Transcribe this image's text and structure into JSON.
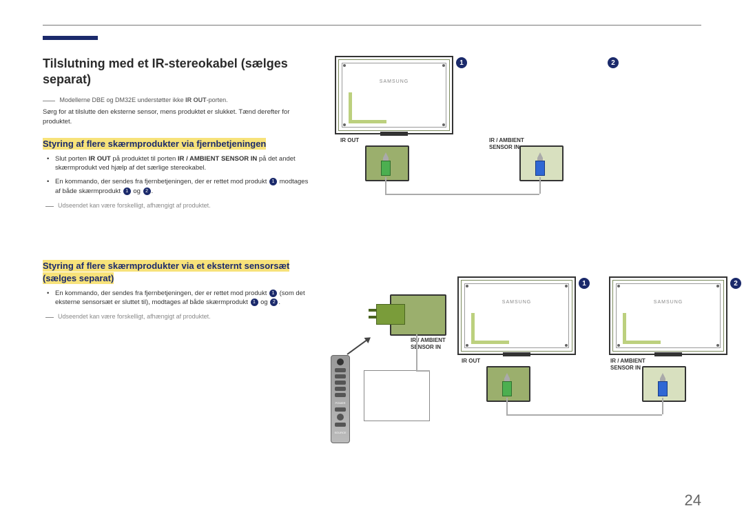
{
  "page_number": "24",
  "title": "Tilslutning med et IR-stereokabel (sælges separat)",
  "note_models_prefix": "Modellerne DBE og DM32E understøtter ikke ",
  "note_models_bold": "IR OUT",
  "note_models_suffix": "-porten.",
  "body1": "Sørg for at tilslutte den eksterne sensor, mens produktet er slukket. Tænd derefter for produktet.",
  "section1": {
    "heading": "Styring af flere skærmprodukter via fjernbetjeningen",
    "bullet1_a": "Slut porten ",
    "bullet1_b": "IR OUT",
    "bullet1_c": " på produktet til porten ",
    "bullet1_d": "IR / AMBIENT SENSOR IN",
    "bullet1_e": " på det andet skærmprodukt ved hjælp af det særlige stereokabel.",
    "bullet2_a": "En kommando, der sendes fra fjernbetjeningen, der er rettet mod produkt ",
    "bullet2_b": " modtages af både skærmprodukt ",
    "bullet2_c": " og ",
    "bullet2_d": ".",
    "note": "Udseendet kan være forskelligt, afhængigt af produktet."
  },
  "section2": {
    "heading": "Styring af flere skærmprodukter via et eksternt sensorsæt (sælges separat)",
    "bullet1_a": "En kommando, der sendes fra fjernbetjeningen, der er rettet mod produkt ",
    "bullet1_b": " (som det eksterne sensorsæt er sluttet til), modtages af både skærmprodukt ",
    "bullet1_c": " og ",
    "bullet1_d": ".",
    "note": "Udseendet kan være forskelligt, afhængigt af produktet."
  },
  "labels": {
    "ir_out": "IR OUT",
    "ir_ambient": "IR / AMBIENT",
    "sensor_in": "SENSOR IN",
    "brand": "SAMSUNG",
    "remote_power": "POWER",
    "remote_source": "SOURCE"
  },
  "bubbles": {
    "one": "1",
    "two": "2"
  }
}
